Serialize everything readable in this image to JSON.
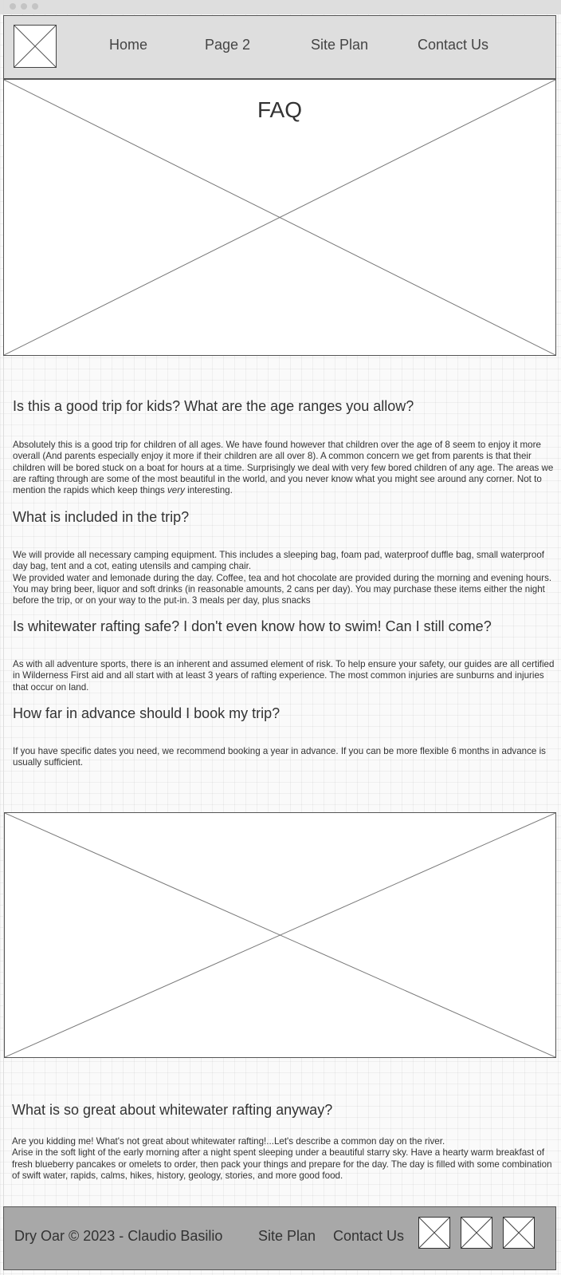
{
  "nav": {
    "links": [
      "Home",
      "Page 2",
      "Site Plan",
      "Contact Us"
    ]
  },
  "hero": {
    "title": "FAQ"
  },
  "faq": [
    {
      "question": "Is this a good trip for kids? What are the age ranges you allow?",
      "answer_before": "Absolutely this is a good trip for children of all ages. We have found however that children over the age of 8 seem to enjoy it more overall (And parents especially enjoy it more if their children are all over 8). A common concern we get from parents is that their children will be bored stuck on a boat for hours at a time. Surprisingly we deal with very few bored children of any age. The areas we are rafting through are some of the most beautiful in the world, and you never know what you might see around any corner. Not to mention the rapids which keep things ",
      "answer_em": "very",
      "answer_after": " interesting."
    },
    {
      "question": "What is included in the trip?",
      "answer_line1": "We will provide all necessary camping equipment. This includes a sleeping bag, foam pad, waterproof duffle bag, small waterproof day bag, tent and a cot, eating utensils and camping chair.",
      "answer_line2": "We provided water and lemonade during the day. Coffee, tea and hot chocolate are provided during the morning and evening hours. You may bring beer, liquor and soft drinks (in reasonable amounts, 2 cans per day). You may purchase these items either the night before the trip, or on your way to the put-in. 3 meals per day, plus snacks"
    },
    {
      "question": "Is whitewater rafting safe? I don't even know how to swim! Can I still come?",
      "answer": "As with all adventure sports, there is an inherent and assumed element of risk. To help ensure your safety, our guides are all certified in Wilderness First aid and all start with at least 3 years of rafting experience. The most common injuries are sunburns and injuries that occur on land."
    },
    {
      "question": "How far in advance should I book my trip?",
      "answer": "If you have specific dates you need, we recommend booking a year in advance. If you can be more flexible 6 months in advance is usually sufficient."
    }
  ],
  "great": {
    "question": "What is so great about whitewater rafting anyway?",
    "answer_line1": "Are you kidding me! What's not great about whitewater rafting!...Let's describe a common day on the river.",
    "answer_line2": "Arise in the soft light of the early morning after a night spent sleeping under a beautiful starry sky. Have a hearty warm breakfast of fresh blueberry pancakes or omelets to order, then pack your things and prepare for the day. The day is filled with some combination of swift water, rapids, calms, hikes, history, geology, stories, and more good food."
  },
  "footer": {
    "copyright": "Dry Oar © 2023 - Claudio Basilio",
    "site_plan": "Site Plan",
    "contact": "Contact Us"
  },
  "colors": {
    "header_bg": "#dedede",
    "footer_bg": "#a8a8a8"
  }
}
